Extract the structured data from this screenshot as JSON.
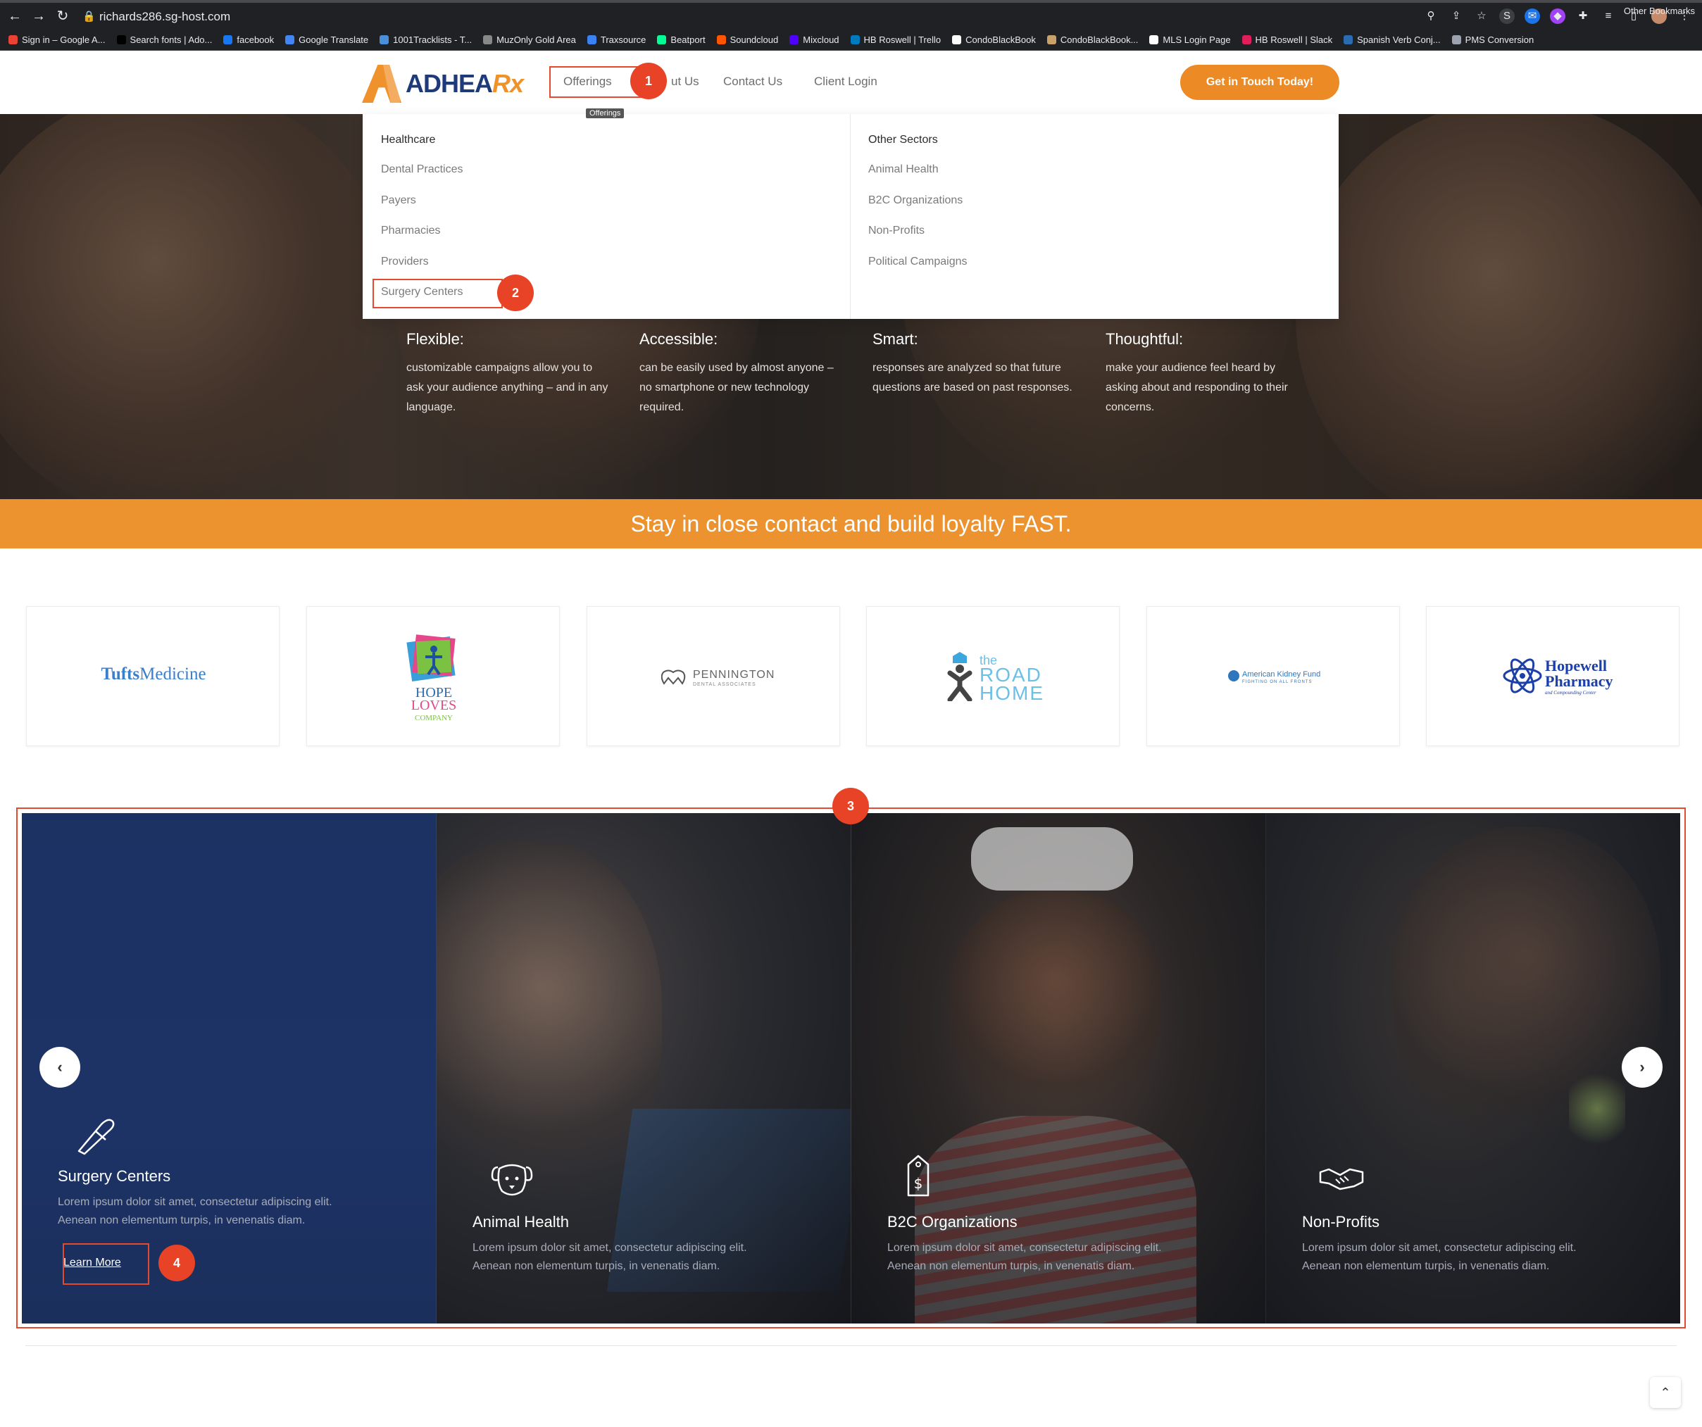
{
  "browser": {
    "url": "richards286.sg-host.com",
    "bookmarks": [
      {
        "label": "Sign in – Google A...",
        "color": "#ea4335"
      },
      {
        "label": "Search fonts | Ado...",
        "color": "#000000"
      },
      {
        "label": "facebook",
        "color": "#1877f2"
      },
      {
        "label": "Google Translate",
        "color": "#4285f4"
      },
      {
        "label": "1001Tracklists - T...",
        "color": "#4a90d9"
      },
      {
        "label": "MuzOnly Gold Area",
        "color": "#888888"
      },
      {
        "label": "Traxsource",
        "color": "#3b82f6"
      },
      {
        "label": "Beatport",
        "color": "#01ff95"
      },
      {
        "label": "Soundcloud",
        "color": "#ff5500"
      },
      {
        "label": "Mixcloud",
        "color": "#5000ff"
      },
      {
        "label": "HB Roswell | Trello",
        "color": "#0079bf"
      },
      {
        "label": "CondoBlackBook",
        "color": "#ffffff"
      },
      {
        "label": "CondoBlackBook...",
        "color": "#c9a26b"
      },
      {
        "label": "MLS Login Page",
        "color": "#ffffff"
      },
      {
        "label": "HB Roswell | Slack",
        "color": "#e01e5a"
      },
      {
        "label": "Spanish Verb Conj...",
        "color": "#2b6cb0"
      },
      {
        "label": "PMS Conversion",
        "color": "#9ca3af"
      }
    ],
    "other_bookmarks": "Other Bookmarks"
  },
  "header": {
    "logo_text": "ADHEA",
    "logo_rx": "Rx",
    "nav": {
      "offerings": "Offerings",
      "about_partial": "ut Us",
      "contact": "Contact Us",
      "client_login": "Client Login"
    },
    "tooltip": "Offerings",
    "cta": "Get in Touch Today!"
  },
  "mega_menu": {
    "healthcare": {
      "heading": "Healthcare",
      "items": [
        "Dental Practices",
        "Payers",
        "Pharmacies",
        "Providers",
        "Surgery Centers"
      ]
    },
    "other": {
      "heading": "Other Sectors",
      "items": [
        "Animal Health",
        "B2C Organizations",
        "Non-Profits",
        "Political Campaigns"
      ]
    }
  },
  "features": [
    {
      "title": "Flexible:",
      "text": "customizable campaigns allow you to ask your audience anything – and in any language."
    },
    {
      "title": "Accessible:",
      "text": "can be easily used by almost anyone – no smartphone or new technology required."
    },
    {
      "title": "Smart:",
      "text": "responses are analyzed so that future questions are based on past responses."
    },
    {
      "title": "Thoughtful:",
      "text": "make your audience feel heard by asking about and responding to their concerns."
    }
  ],
  "band_text": "Stay in close contact and build loyalty FAST.",
  "partners": {
    "tufts_a": "Tufts",
    "tufts_b": "Medicine",
    "hope_1": "HOPE",
    "hope_2": "LOVES",
    "hope_3": "COMPANY",
    "pennington": "PENNINGTON",
    "pennington_sub": "DENTAL ASSOCIATES",
    "road_the": "the",
    "road_1": "ROAD",
    "road_2": "HOME",
    "akf": "American Kidney Fund",
    "akf_sub": "FIGHTING ON ALL FRONTS",
    "hopewell_1": "Hopewell",
    "hopewell_2": "Pharmacy",
    "hopewell_sub": "and Compounding Center"
  },
  "slides": [
    {
      "title": "Surgery Centers",
      "text": "Lorem ipsum dolor sit amet, consectetur adipiscing elit. Aenean non elementum turpis, in venenatis diam.",
      "icon": "scalpel-icon",
      "link": "Learn More"
    },
    {
      "title": "Animal Health",
      "text": "Lorem ipsum dolor sit amet, consectetur adipiscing elit. Aenean non elementum turpis, in venenatis diam.",
      "icon": "dog-icon"
    },
    {
      "title": "B2C Organizations",
      "text": "Lorem ipsum dolor sit amet, consectetur adipiscing elit. Aenean non elementum turpis, in venenatis diam.",
      "icon": "price-tag-icon"
    },
    {
      "title": "Non-Profits",
      "text": "Lorem ipsum dolor sit amet, consectetur adipiscing elit. Aenean non elementum turpis, in venenatis diam.",
      "icon": "handshake-icon"
    }
  ],
  "annotations": [
    "1",
    "2",
    "3",
    "4"
  ],
  "colors": {
    "brand_orange": "#ec8a25",
    "brand_navy": "#1e3a78",
    "annotation_red": "#e84326"
  }
}
